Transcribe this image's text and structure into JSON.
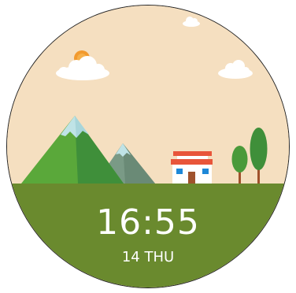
{
  "watch": {
    "time": "16:55",
    "date": "14 THU"
  },
  "colors": {
    "sky": "#f5dfc0",
    "ground": "#6a8a2e",
    "sun": "#f29a2e",
    "cloud": "#ffffff",
    "mountain": "#5aa83a",
    "snow": "#bfe3e6",
    "house_roof": "#e8553a",
    "house_window": "#1e88d8",
    "tree": "#4a9a3a",
    "trunk": "#a0522d",
    "text": "#ffffff"
  },
  "icons": [
    "sun-icon",
    "cloud-icon",
    "mountain-icon",
    "house-icon",
    "tree-icon"
  ]
}
